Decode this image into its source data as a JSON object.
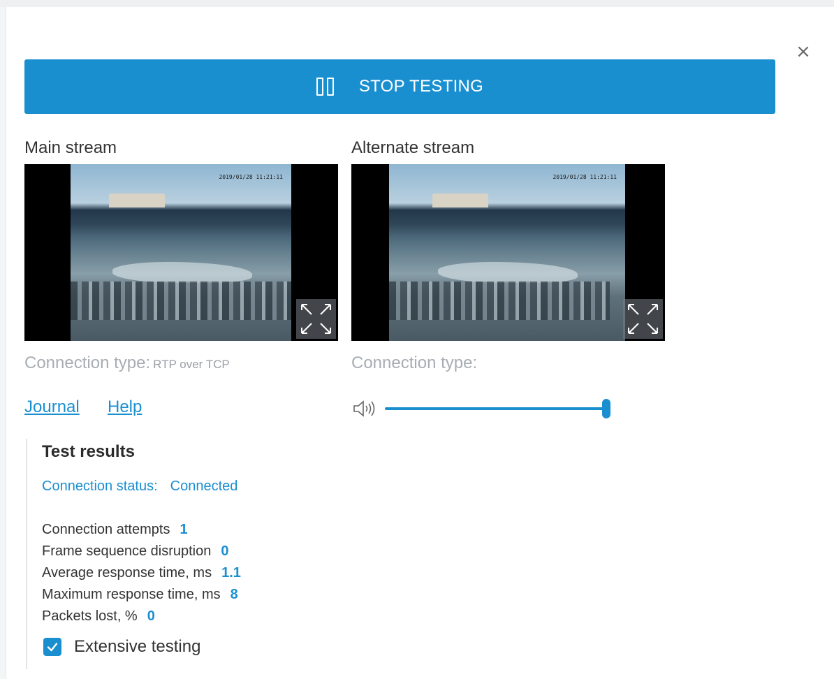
{
  "dialog": {
    "close_glyph": "×"
  },
  "toolbar": {
    "stop_label": "STOP TESTING",
    "stop_icon": "pause-icon",
    "accent_color": "#1a8fd0"
  },
  "streams": {
    "main": {
      "title": "Main stream",
      "timestamp": "2019/01/28 11:21:11",
      "connection_label": "Connection type:",
      "connection_value": "RTP over TCP"
    },
    "alternate": {
      "title": "Alternate stream",
      "timestamp": "2019/01/28 11:21:11",
      "connection_label": "Connection type:",
      "connection_value": ""
    }
  },
  "links": {
    "journal": "Journal",
    "help": "Help"
  },
  "volume": {
    "icon": "speaker-icon",
    "level": 1.0
  },
  "results": {
    "title": "Test results",
    "status_label": "Connection status:",
    "status_value": "Connected",
    "metrics": [
      {
        "label": "Connection attempts",
        "value": "1"
      },
      {
        "label": "Frame sequence disruption",
        "value": "0"
      },
      {
        "label": "Average response time, ms",
        "value": "1.1"
      },
      {
        "label": "Maximum response time, ms",
        "value": "8"
      },
      {
        "label": "Packets lost, %",
        "value": "0"
      }
    ],
    "extensive_label": "Extensive testing",
    "extensive_checked": true
  }
}
